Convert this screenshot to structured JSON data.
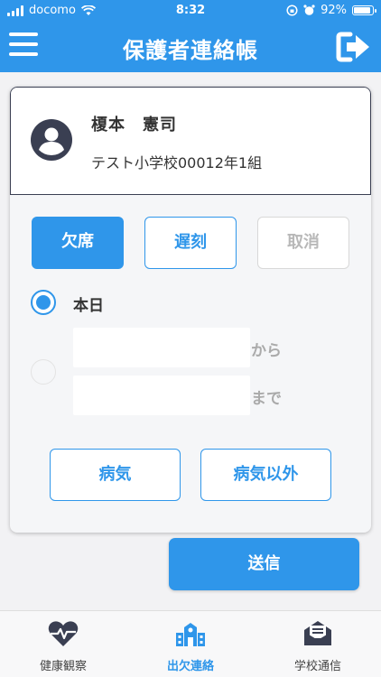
{
  "status_bar": {
    "carrier": "docomo",
    "time": "8:32",
    "battery_percent": "92%",
    "battery_level": 0.92
  },
  "header": {
    "title": "保護者連絡帳",
    "menu_icon": "hamburger-menu-icon",
    "logout_icon": "logout-icon"
  },
  "student": {
    "name": "榎本　憲司",
    "school_class": "テスト小学校00012年1組",
    "avatar_icon": "person-icon"
  },
  "type_buttons": {
    "absent": "欠席",
    "late": "遅刻",
    "cancel": "取消",
    "selected": "absent"
  },
  "period": {
    "today_label": "本日",
    "today_selected": true,
    "from_value": "",
    "to_value": "",
    "from_suffix": "から",
    "to_suffix": "まで"
  },
  "reason_buttons": {
    "illness": "病気",
    "other": "病気以外"
  },
  "send_label": "送信",
  "tabs": [
    {
      "label": "健康観察",
      "icon": "heart-pulse-icon",
      "active": false
    },
    {
      "label": "出欠連絡",
      "icon": "school-building-icon",
      "active": true
    },
    {
      "label": "学校通信",
      "icon": "mail-inbox-icon",
      "active": false
    }
  ],
  "colors": {
    "primary": "#2f96ea",
    "header_bg": "#2f96ea",
    "dark_icon": "#3a3f52"
  }
}
